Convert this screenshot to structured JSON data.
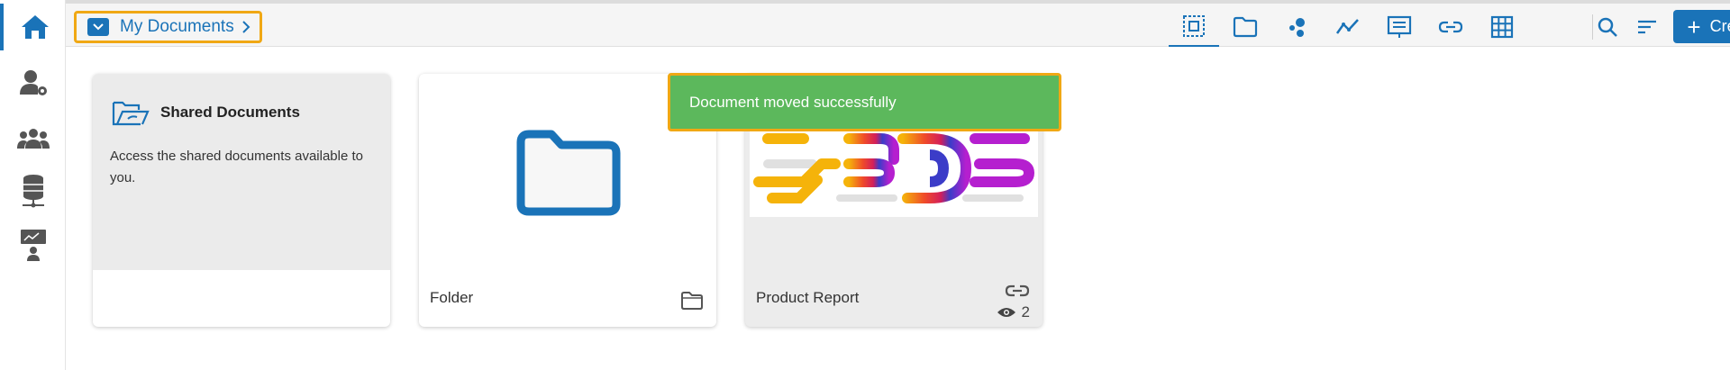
{
  "breadcrumb": {
    "label": "My Documents"
  },
  "toolbar": {
    "create_label": "Create"
  },
  "cards": {
    "shared": {
      "title": "Shared Documents",
      "description": "Access the shared documents available to you."
    },
    "folder": {
      "label": "Folder"
    },
    "report": {
      "label": "Product Report",
      "views": "2"
    }
  },
  "toast": {
    "message": "Document moved successfully"
  },
  "colors": {
    "accent": "#1a73b8",
    "highlight": "#f0a814",
    "toast": "#5cb85c"
  }
}
